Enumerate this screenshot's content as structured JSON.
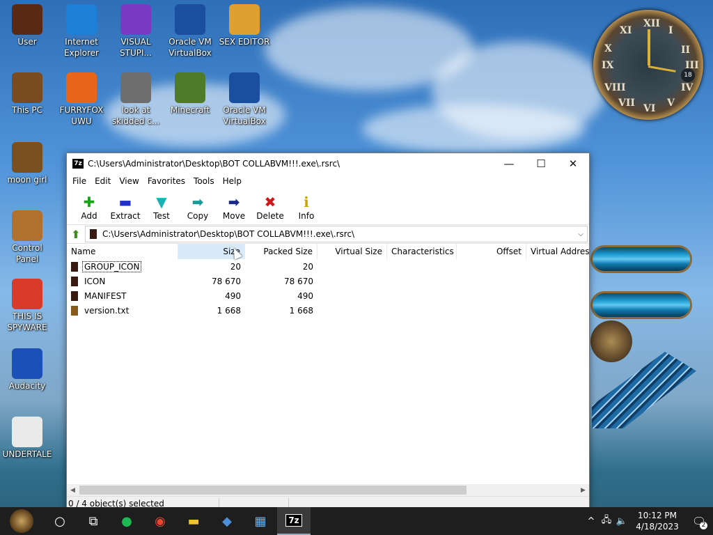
{
  "desktop": {
    "icons": [
      {
        "label": "User",
        "color": "#5a2a14"
      },
      {
        "label": "Internet Explorer",
        "color": "#1e7fd6"
      },
      {
        "label": "VISUAL STUPI...",
        "color": "#7a3ac4"
      },
      {
        "label": "Oracle VM VirtualBox",
        "color": "#1a4fa0"
      },
      {
        "label": "SEX EDITOR",
        "color": "#e0a030"
      },
      {
        "label": "This PC",
        "color": "#7a4a20"
      },
      {
        "label": "FURRYFOX UWU",
        "color": "#e8661a"
      },
      {
        "label": "look at skidded c...",
        "color": "#6e6e6e"
      },
      {
        "label": "Minecraft",
        "color": "#4f7a2a"
      },
      {
        "label": "Oracle VM VirtualBox",
        "color": "#1a4fa0"
      },
      {
        "label": "moon girl",
        "color": "#7a5020"
      },
      {
        "label": "Control Panel",
        "color": "#b07030"
      },
      {
        "label": "THIS IS SPYWARE",
        "color": "#d93b2b"
      },
      {
        "label": "Audacity",
        "color": "#1a50b8"
      },
      {
        "label": "UNDERTALE",
        "color": "#eaeaea"
      }
    ],
    "clock_numerals": [
      "XII",
      "I",
      "II",
      "III",
      "IV",
      "V",
      "VI",
      "VII",
      "VIII",
      "IX",
      "X",
      "XI"
    ],
    "clock_date": "18"
  },
  "window": {
    "app_icon": "7z",
    "title": "C:\\Users\\Administrator\\Desktop\\BOT COLLABVM!!!.exe\\.rsrc\\",
    "controls": {
      "minimize": "—",
      "maximize": "☐",
      "close": "✕"
    },
    "menu": [
      "File",
      "Edit",
      "View",
      "Favorites",
      "Tools",
      "Help"
    ],
    "toolbar": [
      {
        "label": "Add",
        "glyph": "✚",
        "color": "#1aa21a",
        "icon": "add-icon"
      },
      {
        "label": "Extract",
        "glyph": "▬",
        "color": "#2030c8",
        "icon": "extract-icon"
      },
      {
        "label": "Test",
        "glyph": "▼",
        "color": "#19b3b3",
        "icon": "test-icon"
      },
      {
        "label": "Copy",
        "glyph": "➡",
        "color": "#1a9a9a",
        "icon": "copy-icon"
      },
      {
        "label": "Move",
        "glyph": "➡",
        "color": "#1a2a8a",
        "icon": "move-icon"
      },
      {
        "label": "Delete",
        "glyph": "✖",
        "color": "#d01818",
        "icon": "delete-icon"
      },
      {
        "label": "Info",
        "glyph": "ℹ",
        "color": "#c8a800",
        "icon": "info-icon"
      }
    ],
    "address": "C:\\Users\\Administrator\\Desktop\\BOT COLLABVM!!!.exe\\.rsrc\\",
    "columns": [
      "Name",
      "Size",
      "Packed Size",
      "Virtual Size",
      "Characteristics",
      "Offset",
      "Virtual Addres"
    ],
    "rows": [
      {
        "name": "GROUP_ICON",
        "size": "20",
        "packed": "20",
        "type": "folder"
      },
      {
        "name": "ICON",
        "size": "78 670",
        "packed": "78 670",
        "type": "folder"
      },
      {
        "name": "MANIFEST",
        "size": "490",
        "packed": "490",
        "type": "folder"
      },
      {
        "name": "version.txt",
        "size": "1 668",
        "packed": "1 668",
        "type": "file"
      }
    ],
    "status": "0 / 4 object(s) selected"
  },
  "taskbar": {
    "search_glyph": "○",
    "taskview_glyph": "⧉",
    "apps": [
      {
        "name": "spotify",
        "glyph": "●",
        "color": "#1db954"
      },
      {
        "name": "chrome",
        "glyph": "◉",
        "color": "#e9452f"
      },
      {
        "name": "explorer",
        "glyph": "▬",
        "color": "#f2c230"
      },
      {
        "name": "virtualbox",
        "glyph": "◆",
        "color": "#4a8fd8"
      },
      {
        "name": "calculator",
        "glyph": "▦",
        "color": "#6ab0e8"
      },
      {
        "name": "7zip",
        "glyph": "7z",
        "color": "#ffffff"
      }
    ],
    "tray": {
      "chevron": "^",
      "network": "🖧",
      "volume": "🔈",
      "time": "10:12 PM",
      "date": "4/18/2023",
      "notif_count": "2"
    }
  }
}
